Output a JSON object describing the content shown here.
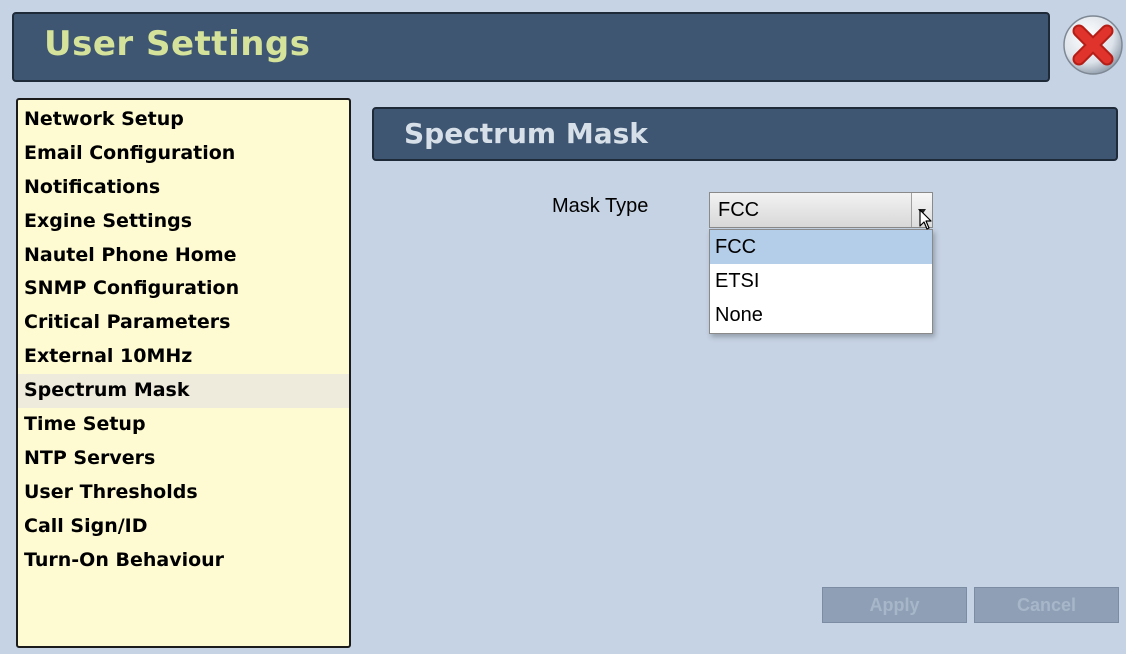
{
  "window": {
    "title": "User Settings"
  },
  "sidebar": {
    "items": [
      {
        "label": "Network Setup"
      },
      {
        "label": "Email Configuration"
      },
      {
        "label": "Notifications"
      },
      {
        "label": "Exgine Settings"
      },
      {
        "label": "Nautel Phone Home"
      },
      {
        "label": "SNMP Configuration"
      },
      {
        "label": "Critical Parameters"
      },
      {
        "label": "External 10MHz"
      },
      {
        "label": "Spectrum Mask",
        "selected": true
      },
      {
        "label": "Time Setup"
      },
      {
        "label": "NTP Servers"
      },
      {
        "label": "User Thresholds"
      },
      {
        "label": "Call Sign/ID"
      },
      {
        "label": "Turn-On Behaviour"
      }
    ]
  },
  "main": {
    "section_title": "Spectrum Mask",
    "mask_type": {
      "label": "Mask Type",
      "value": "FCC",
      "options": [
        "FCC",
        "ETSI",
        "None"
      ],
      "highlighted": "FCC"
    },
    "buttons": {
      "apply": "Apply",
      "cancel": "Cancel"
    }
  },
  "icons": {
    "close": "close-icon",
    "dropdown": "chevron-down-icon",
    "cursor": "mouse-pointer-icon"
  },
  "colors": {
    "background": "#c6d3e4",
    "header": "#3f5673",
    "title_text": "#d4e29a",
    "sidebar_bg": "#fefbd3",
    "sidebar_selected": "#efebdc",
    "option_highlight": "#b4cde9",
    "close_red": "#e0332b"
  }
}
